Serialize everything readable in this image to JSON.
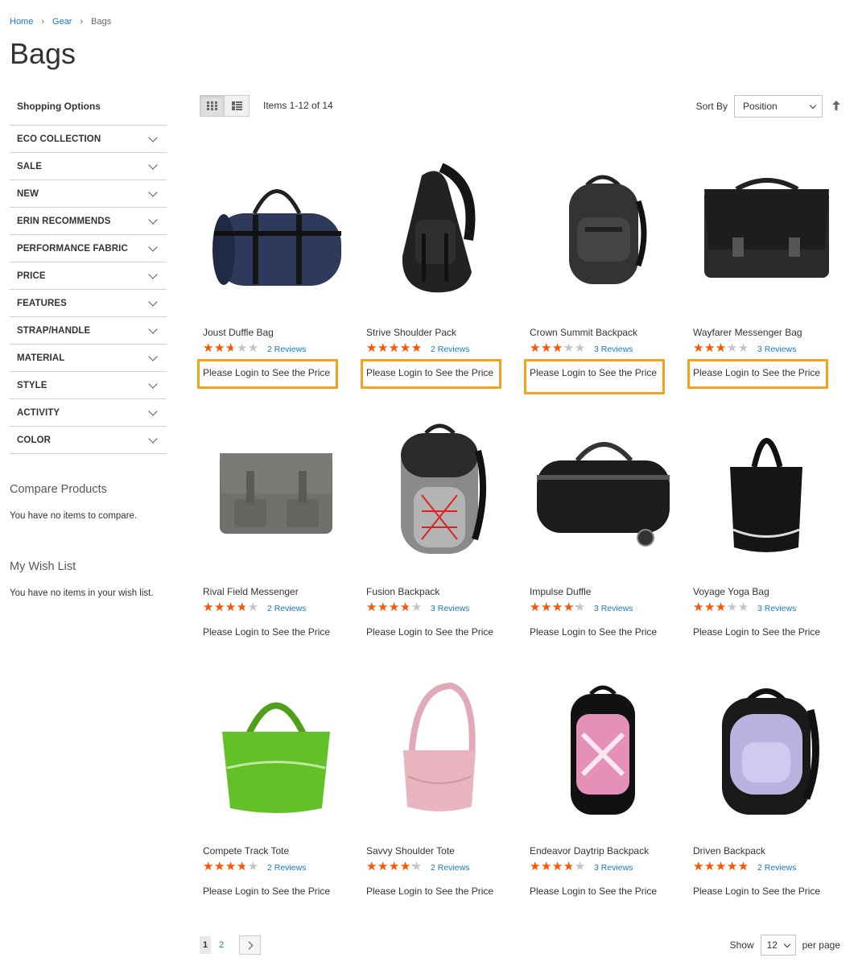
{
  "breadcrumbs": {
    "home": "Home",
    "gear": "Gear",
    "current": "Bags",
    "separator": "›"
  },
  "page_title": "Bags",
  "sidebar": {
    "title": "Shopping Options",
    "filters": [
      {
        "label": "ECO COLLECTION"
      },
      {
        "label": "SALE"
      },
      {
        "label": "NEW"
      },
      {
        "label": "ERIN RECOMMENDS"
      },
      {
        "label": "PERFORMANCE FABRIC"
      },
      {
        "label": "PRICE"
      },
      {
        "label": "FEATURES"
      },
      {
        "label": "STRAP/HANDLE"
      },
      {
        "label": "MATERIAL"
      },
      {
        "label": "STYLE"
      },
      {
        "label": "ACTIVITY"
      },
      {
        "label": "COLOR"
      }
    ],
    "compare": {
      "title": "Compare Products",
      "empty": "You have no items to compare."
    },
    "wishlist": {
      "title": "My Wish List",
      "empty": "You have no items in your wish list."
    }
  },
  "toolbar": {
    "amount": "Items 1-12 of 14",
    "sort_label": "Sort By",
    "sort_value": "Position",
    "view_modes": [
      "grid-icon",
      "list-icon"
    ]
  },
  "colors": {
    "star": "#ff5501",
    "star_empty": "#c4c4c4",
    "link": "#1979c3",
    "highlight": "#f3a31b"
  },
  "products": [
    {
      "name": "Joust Duffle Bag",
      "rating": 0.5,
      "reviews": "2  Reviews",
      "price_note": "Please Login to See the Price",
      "highlighted": true,
      "icon": "duffle-bag-image"
    },
    {
      "name": "Strive Shoulder Pack",
      "rating": 0.9,
      "reviews": "2  Reviews",
      "price_note": "Please Login to See the Price",
      "highlighted": true,
      "icon": "sling-backpack-image"
    },
    {
      "name": "Crown Summit Backpack",
      "rating": 0.6,
      "reviews": "3  Reviews",
      "price_note": "Please Login to See the Price",
      "highlighted": true,
      "icon": "backpack-image"
    },
    {
      "name": "Wayfarer Messenger Bag",
      "rating": 0.6,
      "reviews": "3  Reviews",
      "price_note": "Please Login to See the Price",
      "highlighted": true,
      "icon": "messenger-bag-image"
    },
    {
      "name": "Rival Field Messenger",
      "rating": 0.7,
      "reviews": "2  Reviews",
      "price_note": "Please Login to See the Price",
      "highlighted": false,
      "icon": "field-messenger-image"
    },
    {
      "name": "Fusion Backpack",
      "rating": 0.7,
      "reviews": "3  Reviews",
      "price_note": "Please Login to See the Price",
      "highlighted": false,
      "icon": "fusion-backpack-image"
    },
    {
      "name": "Impulse Duffle",
      "rating": 0.8,
      "reviews": "3  Reviews",
      "price_note": "Please Login to See the Price",
      "highlighted": false,
      "icon": "rolling-duffle-image"
    },
    {
      "name": "Voyage Yoga Bag",
      "rating": 0.6,
      "reviews": "3  Reviews",
      "price_note": "Please Login to See the Price",
      "highlighted": false,
      "icon": "tote-bag-image"
    },
    {
      "name": "Compete Track Tote",
      "rating": 0.7,
      "reviews": "2  Reviews",
      "price_note": "Please Login to See the Price",
      "highlighted": false,
      "icon": "green-tote-image"
    },
    {
      "name": "Savvy Shoulder Tote",
      "rating": 0.8,
      "reviews": "2  Reviews",
      "price_note": "Please Login to See the Price",
      "highlighted": false,
      "icon": "pink-tote-image"
    },
    {
      "name": "Endeavor Daytrip Backpack",
      "rating": 0.7,
      "reviews": "3  Reviews",
      "price_note": "Please Login to See the Price",
      "highlighted": false,
      "icon": "pink-backpack-image"
    },
    {
      "name": "Driven Backpack",
      "rating": 0.9,
      "reviews": "2  Reviews",
      "price_note": "Please Login to See the Price",
      "highlighted": false,
      "icon": "lavender-backpack-image"
    }
  ],
  "pagination": {
    "pages": [
      "1",
      "2"
    ],
    "current": "1"
  },
  "limiter": {
    "show_label": "Show",
    "value": "12",
    "per_page_label": "per page"
  }
}
